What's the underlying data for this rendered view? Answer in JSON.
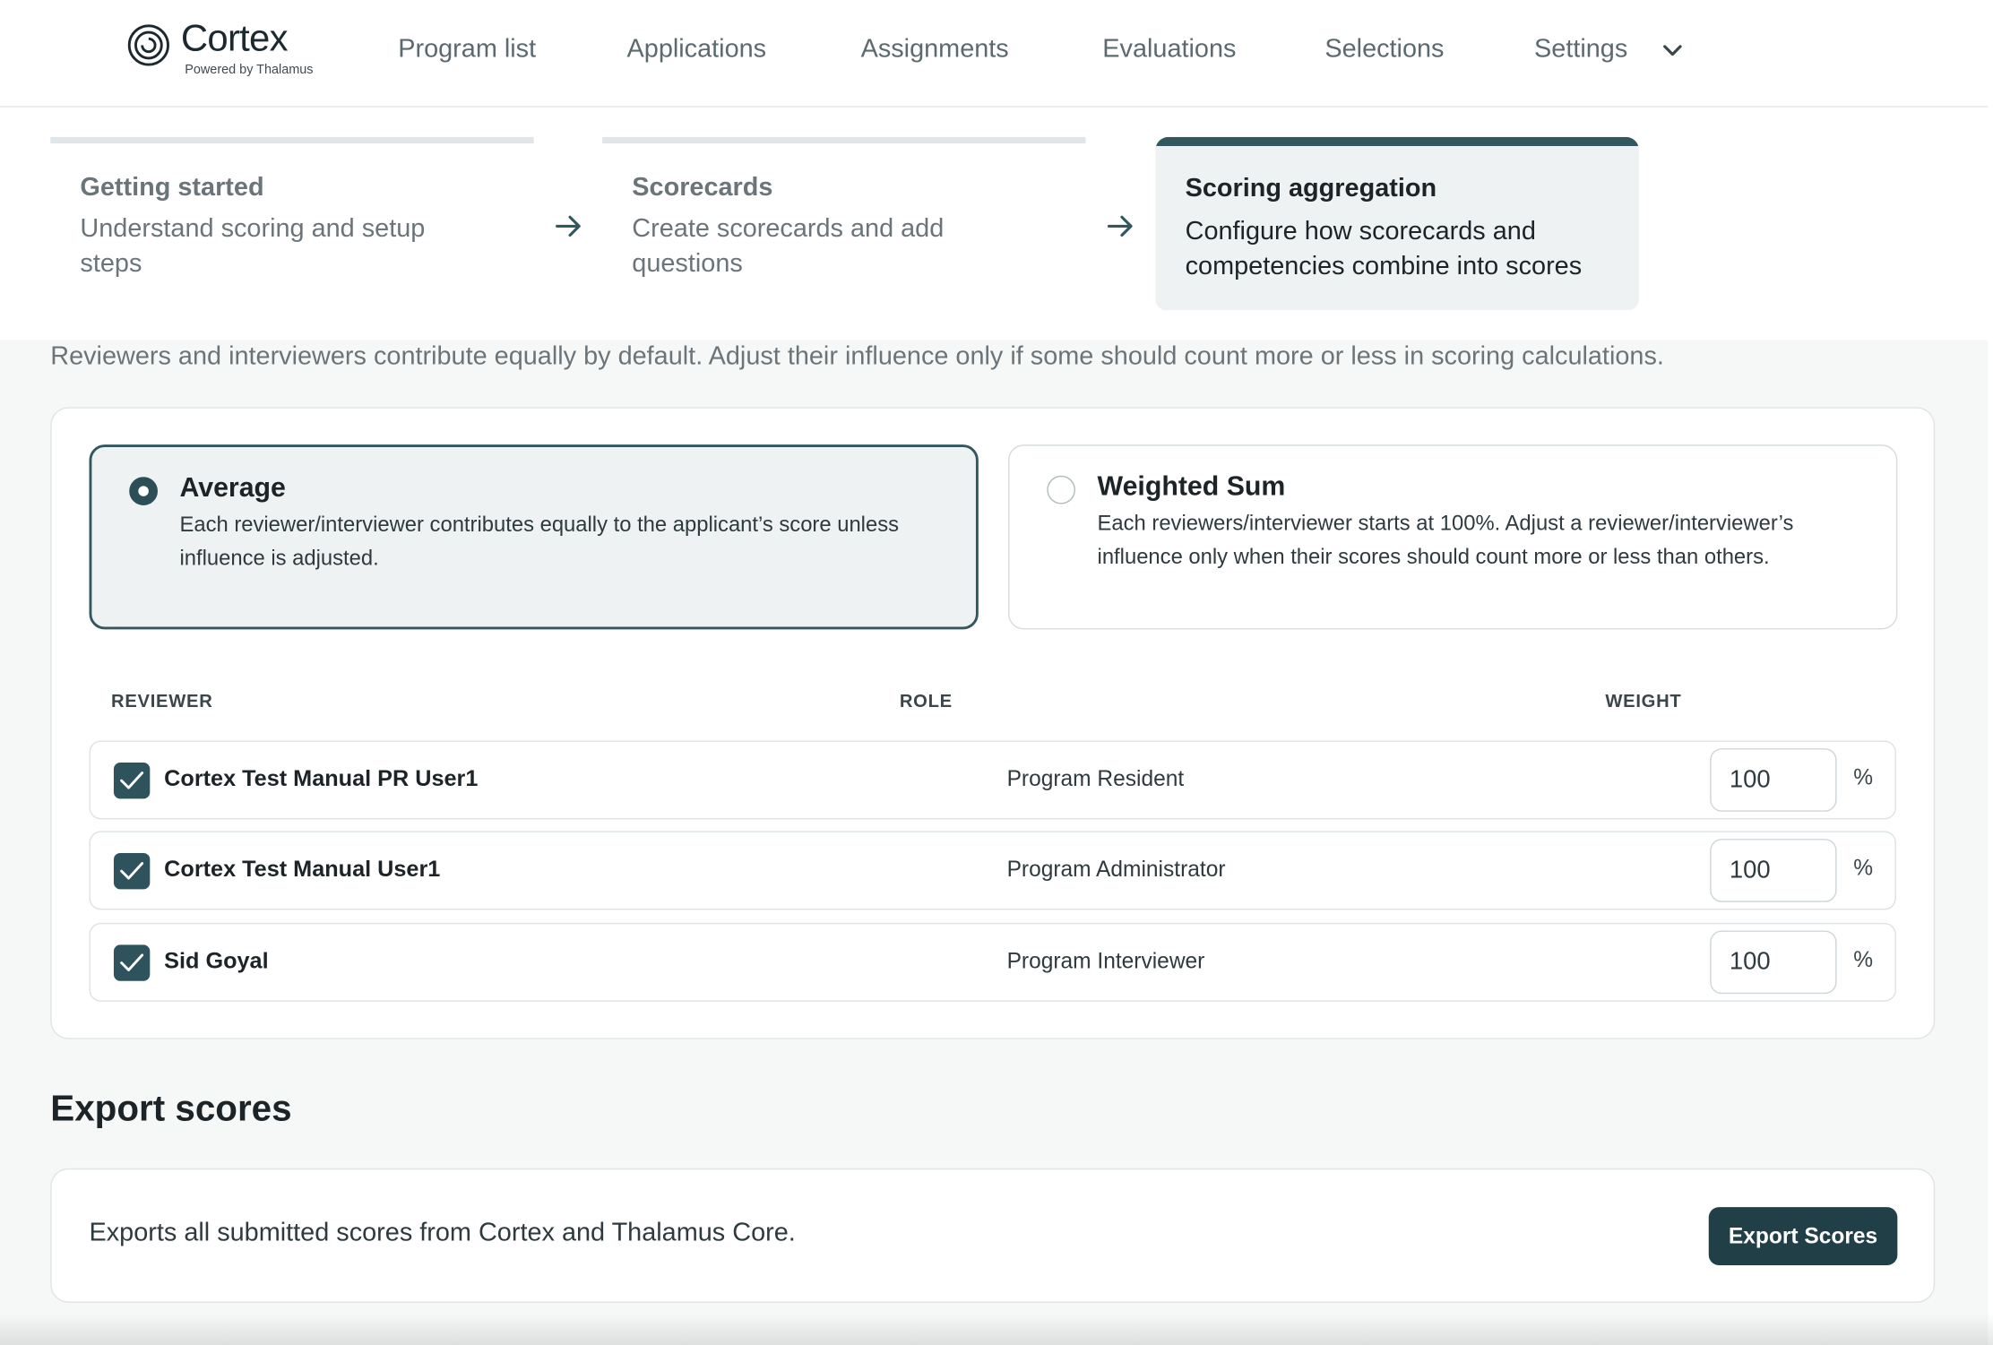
{
  "app": {
    "logo_name": "Cortex",
    "logo_sub": "Powered by Thalamus"
  },
  "nav": {
    "items": [
      "Program list",
      "Applications",
      "Assignments",
      "Evaluations",
      "Selections",
      "Settings"
    ]
  },
  "stepper": {
    "steps": [
      {
        "title": "Getting started",
        "desc": "Understand scoring and setup steps",
        "state": "inactive"
      },
      {
        "title": "Scorecards",
        "desc": "Create scorecards and add questions",
        "state": "inactive"
      },
      {
        "title": "Scoring aggregation",
        "desc": "Configure how scorecards and competencies combine into scores",
        "state": "active"
      }
    ]
  },
  "intro": "Reviewers and interviewers contribute equally by default. Adjust their influence only if some should count more or less in scoring calculations.",
  "aggregation": {
    "selected": "average",
    "options": [
      {
        "id": "average",
        "title": "Average",
        "desc": "Each reviewer/interviewer contributes equally to the applicant’s score unless influence is adjusted."
      },
      {
        "id": "weighted",
        "title": "Weighted Sum",
        "desc": "Each reviewers/interviewer starts at 100%. Adjust a reviewer/interviewer’s influence only when their scores should count more or less than others."
      }
    ]
  },
  "table": {
    "headers": {
      "reviewer": "REVIEWER",
      "role": "ROLE",
      "weight": "WEIGHT"
    },
    "unit": "%",
    "rows": [
      {
        "name": "Cortex Test Manual PR User1",
        "role": "Program Resident",
        "weight": "100",
        "checked": true
      },
      {
        "name": "Cortex Test Manual User1",
        "role": "Program Administrator",
        "weight": "100",
        "checked": true
      },
      {
        "name": "Sid Goyal",
        "role": "Program Interviewer",
        "weight": "100",
        "checked": true
      }
    ]
  },
  "export": {
    "heading": "Export scores",
    "text": "Exports all submitted scores from Cortex and Thalamus Core.",
    "button": "Export Scores"
  },
  "colors": {
    "accent": "#33575f",
    "button": "#213f47",
    "muted_text": "#6b7579"
  },
  "icons": {
    "logo": "cortex-spiral-icon",
    "settings_chevron": "chevron-down-icon",
    "step_arrow": "arrow-right-icon",
    "checkbox": "check-icon"
  }
}
